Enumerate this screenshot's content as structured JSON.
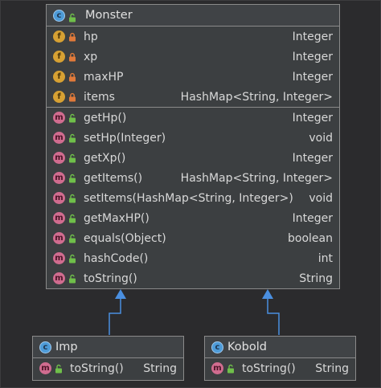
{
  "colors": {
    "background": "#2b2b2d",
    "box_fill": "#3c3f41",
    "box_border": "#8a8a8a",
    "arrow": "#4a8fe0",
    "class_icon": "#4d9bd8",
    "field_icon": "#d7a133",
    "method_icon": "#d06c8f",
    "lock_private": "#e07a3a",
    "lock_public": "#6fbf4a"
  },
  "monster": {
    "name": "Monster",
    "icon": "class-icon",
    "fields": [
      {
        "name": "hp",
        "type": "Integer",
        "icon": "field-icon",
        "visibility": "private"
      },
      {
        "name": "xp",
        "type": "Integer",
        "icon": "field-icon",
        "visibility": "private"
      },
      {
        "name": "maxHP",
        "type": "Integer",
        "icon": "field-icon",
        "visibility": "private"
      },
      {
        "name": "items",
        "type": "HashMap<String, Integer>",
        "icon": "field-icon",
        "visibility": "private"
      }
    ],
    "methods": [
      {
        "name": "getHp()",
        "type": "Integer",
        "icon": "method-icon",
        "visibility": "public"
      },
      {
        "name": "setHp(Integer)",
        "type": "void",
        "icon": "method-icon",
        "visibility": "public"
      },
      {
        "name": "getXp()",
        "type": "Integer",
        "icon": "method-icon",
        "visibility": "public"
      },
      {
        "name": "getItems()",
        "type": "HashMap<String, Integer>",
        "icon": "method-icon",
        "visibility": "public"
      },
      {
        "name": "setItems(HashMap<String, Integer>)",
        "type": "void",
        "icon": "method-icon",
        "visibility": "public"
      },
      {
        "name": "getMaxHP()",
        "type": "Integer",
        "icon": "method-icon",
        "visibility": "public"
      },
      {
        "name": "equals(Object)",
        "type": "boolean",
        "icon": "method-icon",
        "visibility": "public"
      },
      {
        "name": "hashCode()",
        "type": "int",
        "icon": "method-icon",
        "visibility": "public"
      },
      {
        "name": "toString()",
        "type": "String",
        "icon": "method-icon",
        "visibility": "public"
      }
    ]
  },
  "imp": {
    "name": "Imp",
    "icon": "class-icon",
    "methods": [
      {
        "name": "toString()",
        "type": "String",
        "icon": "method-icon",
        "visibility": "public"
      }
    ]
  },
  "kobold": {
    "name": "Kobold",
    "icon": "class-icon",
    "methods": [
      {
        "name": "toString()",
        "type": "String",
        "icon": "method-icon",
        "visibility": "public"
      }
    ]
  }
}
